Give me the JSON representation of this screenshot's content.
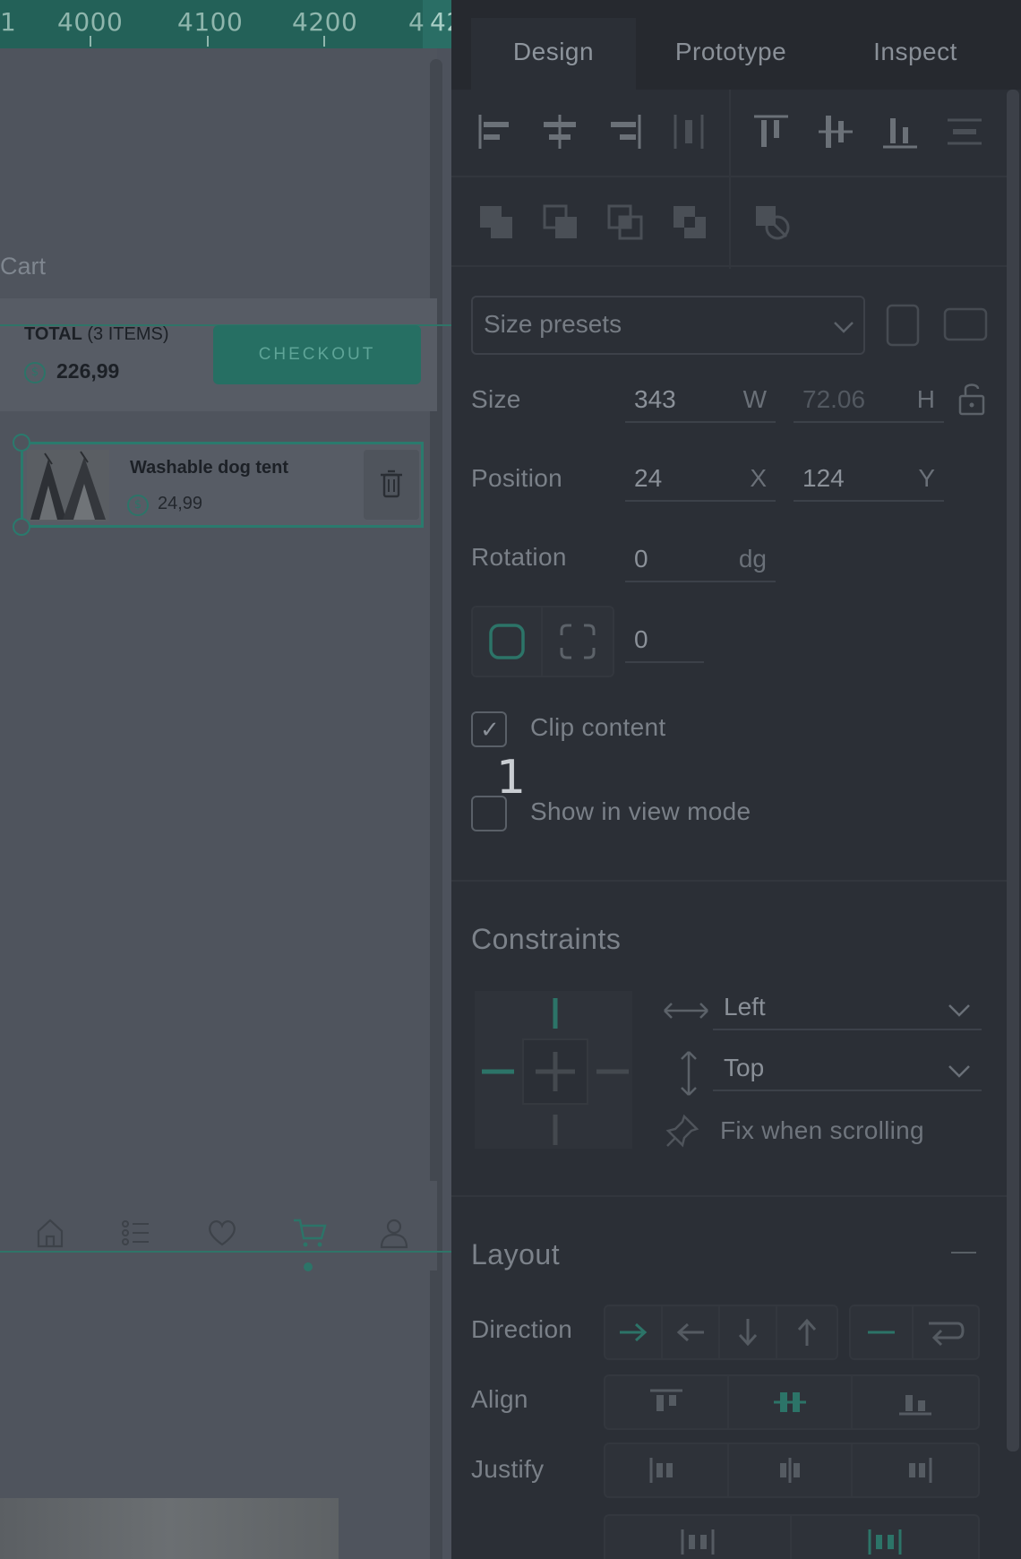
{
  "ruler": {
    "ticks": [
      "1",
      "4000",
      "4100",
      "4200",
      "4",
      "42"
    ]
  },
  "cart": {
    "title": "Cart",
    "total_label_bold": "TOTAL",
    "total_label_rest": " (3 ITEMS)",
    "currency_symbol": "$",
    "total_value": "226,99",
    "checkout_label": "CHECKOUT",
    "item": {
      "name": "Washable dog tent",
      "price": "24,99"
    }
  },
  "panel": {
    "tabs": [
      "Design",
      "Prototype",
      "Inspect"
    ],
    "active_tab": "Design",
    "size_presets": {
      "placeholder": "Size presets"
    },
    "size": {
      "label": "Size",
      "w": "343",
      "w_unit": "W",
      "h": "72.06",
      "h_unit": "H"
    },
    "position": {
      "label": "Position",
      "x": "24",
      "x_unit": "X",
      "y": "124",
      "y_unit": "Y"
    },
    "rotation": {
      "label": "Rotation",
      "value": "0",
      "unit": "dg"
    },
    "radius": {
      "value": "0"
    },
    "clip_content": {
      "label": "Clip content",
      "checked": true,
      "check_glyph": "✓"
    },
    "show_in_view_mode": {
      "label": "Show in view mode",
      "checked": false
    },
    "constraints": {
      "title": "Constraints",
      "horizontal": "Left",
      "vertical": "Top",
      "fix_label": "Fix when scrolling"
    },
    "layout": {
      "title": "Layout",
      "collapse_glyph": "—",
      "direction_label": "Direction",
      "align_label": "Align",
      "justify_label": "Justify"
    }
  },
  "annotation": "1",
  "colors": {
    "accent": "#2a7a6d",
    "panel_bg": "#2b2f36",
    "canvas_bg": "#4f545d"
  }
}
